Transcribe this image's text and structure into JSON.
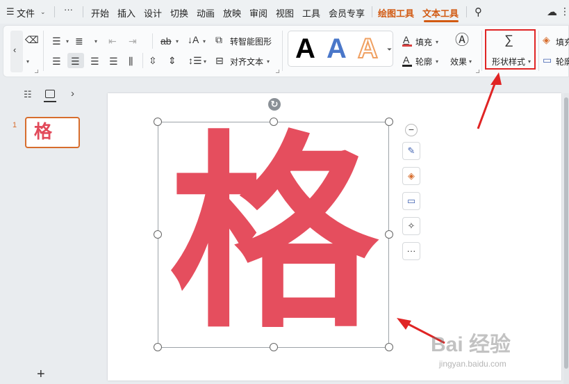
{
  "menubar": {
    "file": "文件",
    "more": "···",
    "tabs": [
      "开始",
      "插入",
      "设计",
      "切换",
      "动画",
      "放映",
      "审阅",
      "视图",
      "工具",
      "会员专享",
      "绘图工具",
      "文本工具"
    ],
    "accent": "#d25a12"
  },
  "ribbon": {
    "smart_shape": "转智能图形",
    "align_text": "对齐文本",
    "fill": "填充",
    "outline": "轮廓",
    "effect": "效果",
    "shape_style": "形状样式",
    "fill_right": "填充",
    "outline_right": "轮廓",
    "gallery": [
      "A",
      "A",
      "A"
    ],
    "gallery_colors": [
      "#000000",
      "#4a77c9",
      "#f0a061"
    ]
  },
  "slide_panel": {
    "slide_number": "1",
    "thumb_text": "格",
    "add": "+"
  },
  "slide": {
    "text": "格",
    "text_color": "#e54e5e"
  },
  "float_toolbar": {
    "more": "···"
  },
  "watermark": {
    "logo": "Bai 经验",
    "url": "jingyan.baidu.com"
  }
}
